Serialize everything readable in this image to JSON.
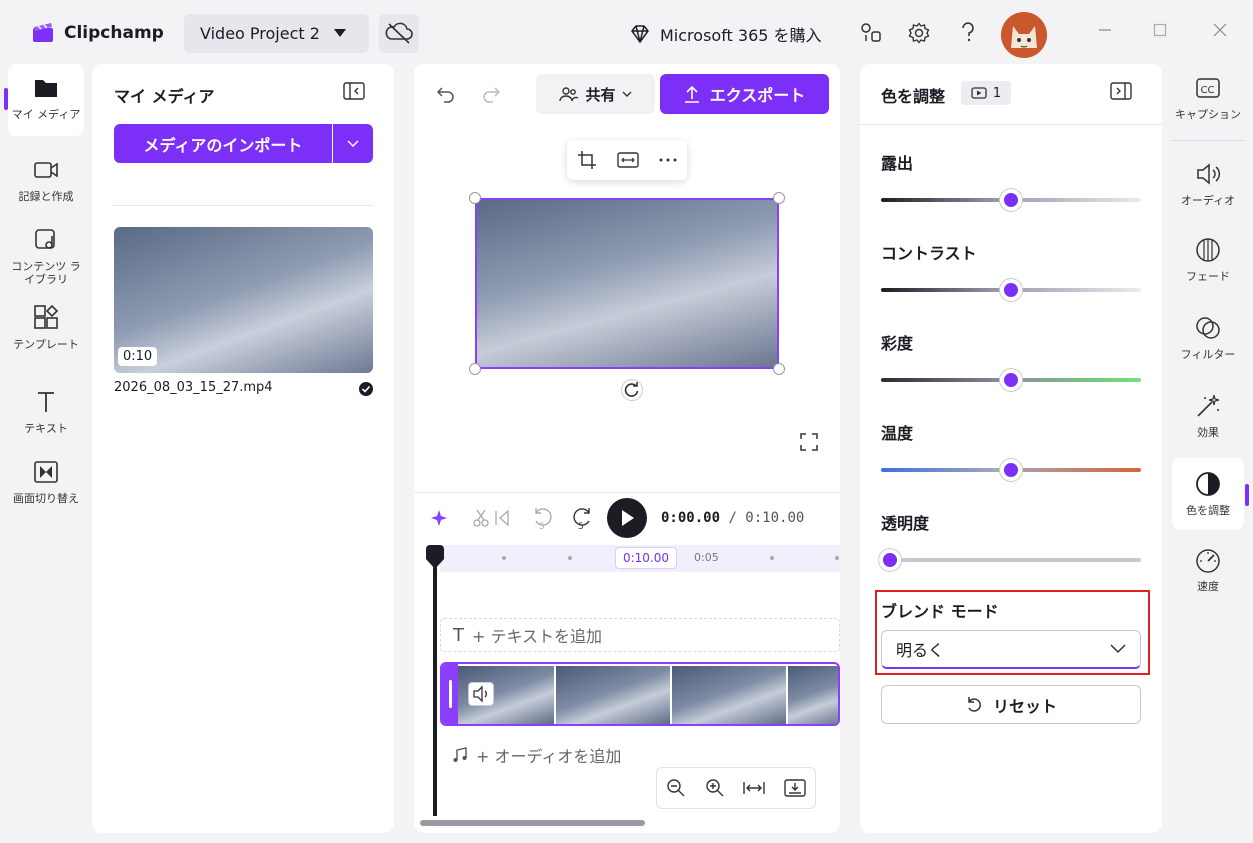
{
  "app": {
    "name": "Clipchamp",
    "project": "Video Project 2",
    "ms365": "Microsoft 365 を購入"
  },
  "nav": {
    "items": [
      {
        "label": "マイ メディア"
      },
      {
        "label": "記録と作成"
      },
      {
        "label": "コンテンツ ライブラリ"
      },
      {
        "label": "テンプレート"
      },
      {
        "label": "テキスト"
      },
      {
        "label": "画面切り替え"
      }
    ]
  },
  "media": {
    "title": "マイ メディア",
    "import_label": "メディアのインポート",
    "file": {
      "name": "2026_08_03_15_27.mp4",
      "duration": "0:10"
    }
  },
  "toolbar": {
    "share_label": "共有",
    "export_label": "エクスポート"
  },
  "playback": {
    "current": "0:00.00",
    "total": "/ 0:10.00",
    "rewind_seconds": "5",
    "forward_seconds": "5"
  },
  "timeline": {
    "marker_label": "0:10.00",
    "tick_label": "0:05",
    "add_text": "+ テキストを追加",
    "add_audio": "+ オーディオを追加",
    "text_glyph": "T"
  },
  "adjust": {
    "title": "色を調整",
    "clip_count": "1",
    "exposure": {
      "label": "露出",
      "value": 0.5
    },
    "contrast": {
      "label": "コントラスト",
      "value": 0.5
    },
    "saturation": {
      "label": "彩度",
      "value": 0.5
    },
    "temperature": {
      "label": "温度",
      "value": 0.5
    },
    "opacity": {
      "label": "透明度",
      "value": 0.0
    },
    "blend": {
      "label": "ブレンド モード",
      "value": "明るく"
    },
    "reset_label": "リセット"
  },
  "right_nav": {
    "items": [
      {
        "label": "キャプション"
      },
      {
        "label": "オーディオ"
      },
      {
        "label": "フェード"
      },
      {
        "label": "フィルター"
      },
      {
        "label": "効果"
      },
      {
        "label": "色を調整"
      },
      {
        "label": "速度"
      }
    ]
  },
  "colors": {
    "accent": "#7b2ff7",
    "highlight_box": "#e02020"
  }
}
